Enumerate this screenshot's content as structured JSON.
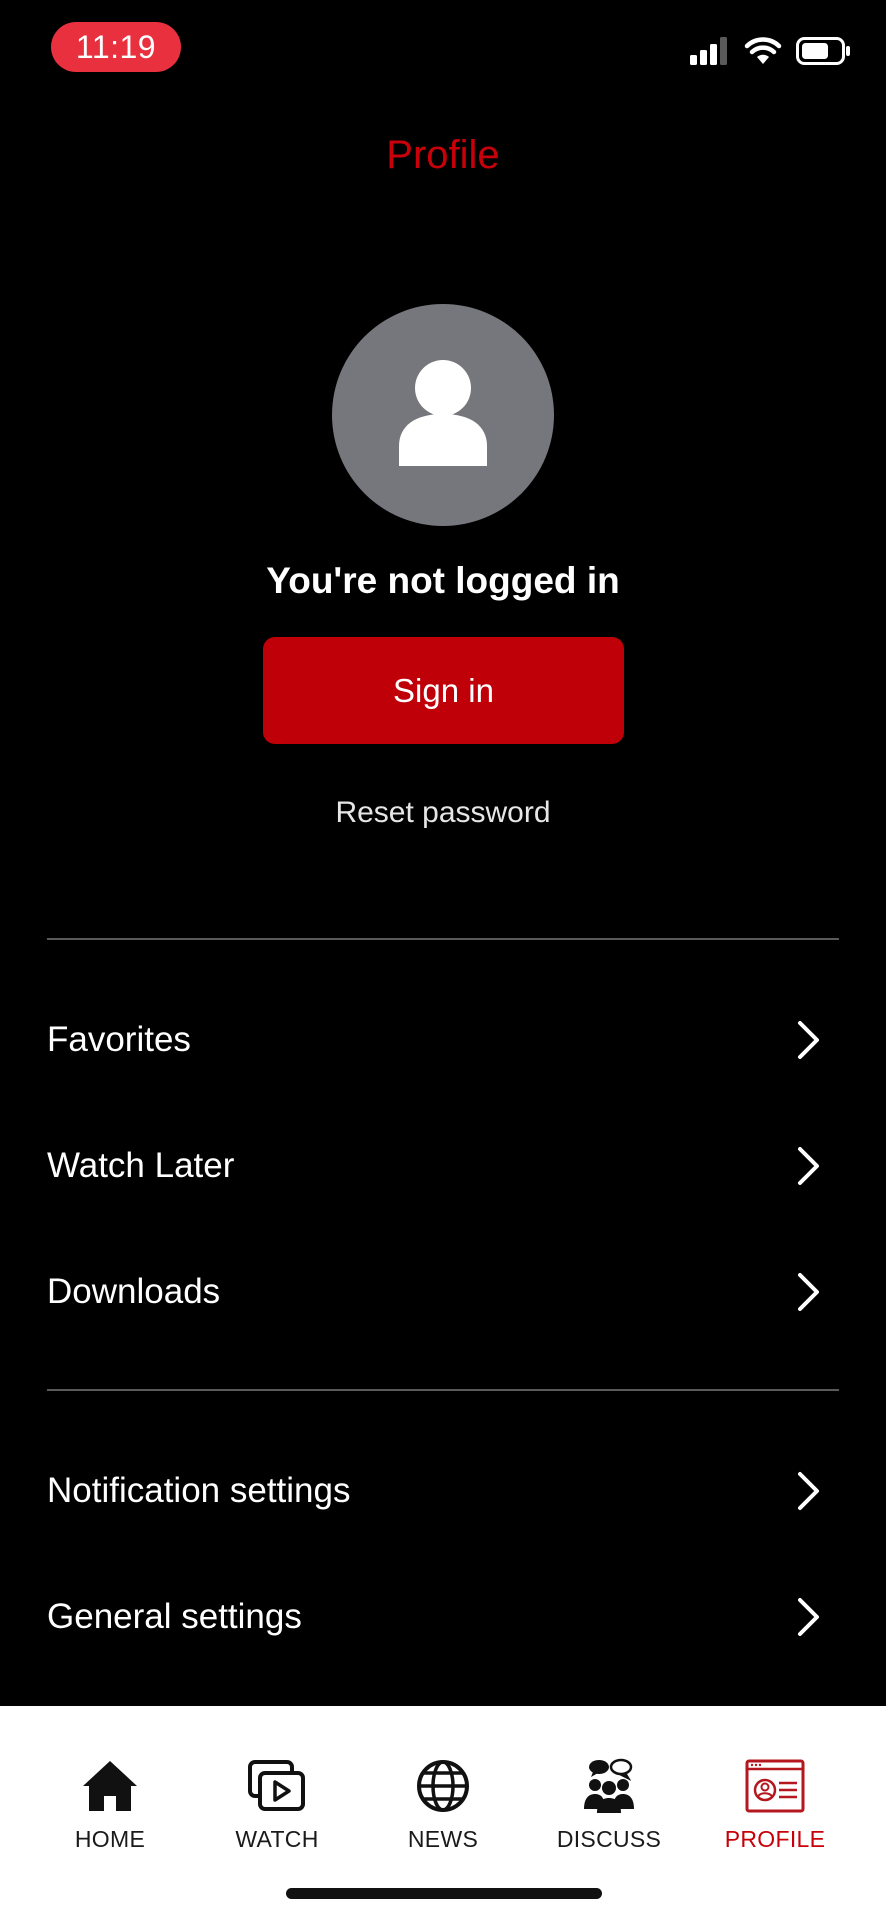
{
  "colors": {
    "accent": "#c8000a",
    "time_pill": "#e8303f",
    "button": "#bf0008",
    "avatar": "#76767d"
  },
  "status_bar": {
    "time": "11:19",
    "icons": [
      "cellular-signal-icon",
      "wifi-icon",
      "battery-icon"
    ]
  },
  "header": {
    "title": "Profile"
  },
  "profile": {
    "avatar_icon": "user-icon",
    "status_text": "You're not logged in",
    "signin_label": "Sign in",
    "reset_label": "Reset password"
  },
  "menu": {
    "group1": [
      {
        "label": "Favorites",
        "icon": "chevron-right-icon"
      },
      {
        "label": "Watch Later",
        "icon": "chevron-right-icon"
      },
      {
        "label": "Downloads",
        "icon": "chevron-right-icon"
      }
    ],
    "group2": [
      {
        "label": "Notification settings",
        "icon": "chevron-right-icon"
      },
      {
        "label": "General settings",
        "icon": "chevron-right-icon"
      }
    ]
  },
  "tabs": [
    {
      "label": "HOME",
      "icon": "home-icon",
      "active": false
    },
    {
      "label": "WATCH",
      "icon": "watch-icon",
      "active": false
    },
    {
      "label": "NEWS",
      "icon": "globe-icon",
      "active": false
    },
    {
      "label": "DISCUSS",
      "icon": "discuss-icon",
      "active": false
    },
    {
      "label": "PROFILE",
      "icon": "profile-card-icon",
      "active": true
    }
  ]
}
